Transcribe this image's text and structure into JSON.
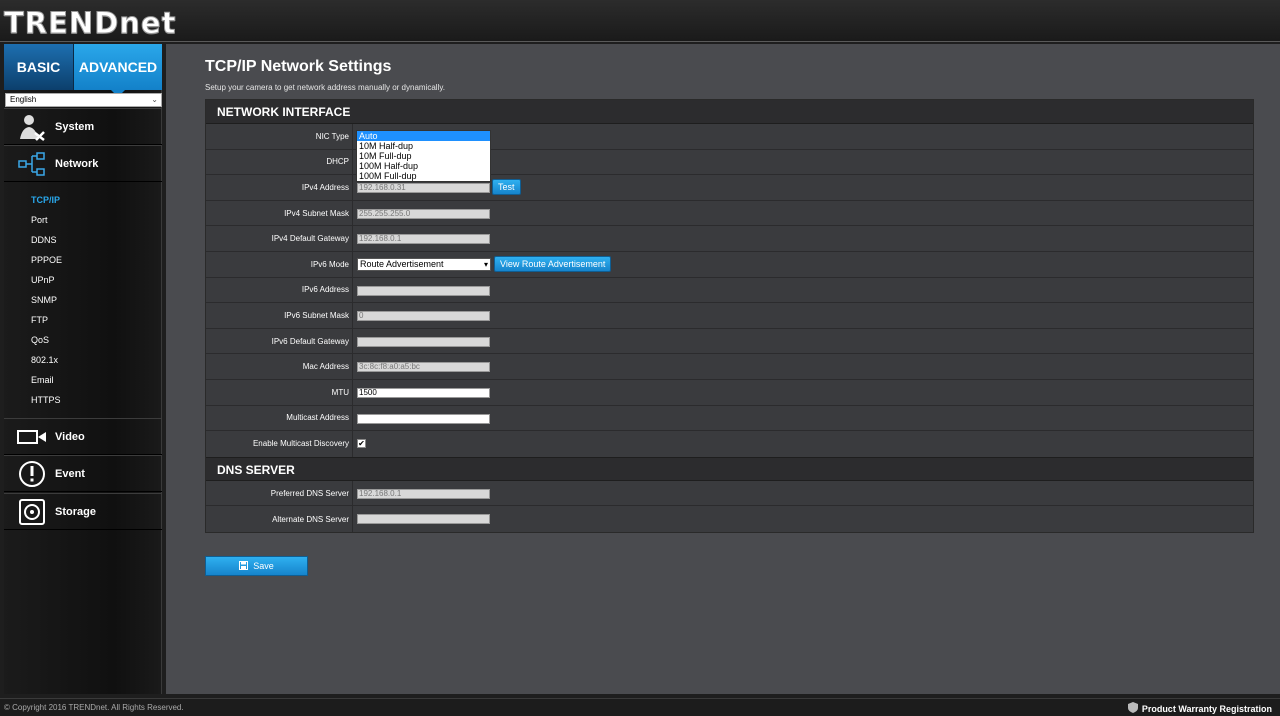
{
  "brand": {
    "logo_text": "TRENDnet"
  },
  "tabs": {
    "basic": "BASIC",
    "advanced": "ADVANCED"
  },
  "language": {
    "selected": "English"
  },
  "menu": {
    "system": "System",
    "network": "Network",
    "video": "Video",
    "event": "Event",
    "storage": "Storage"
  },
  "submenu": [
    "TCP/IP",
    "Port",
    "DDNS",
    "PPPOE",
    "UPnP",
    "SNMP",
    "FTP",
    "QoS",
    "802.1x",
    "Email",
    "HTTPS"
  ],
  "page": {
    "title": "TCP/IP Network Settings",
    "subtitle": "Setup your camera to get network address manually or dynamically."
  },
  "network_interface": {
    "heading": "NETWORK INTERFACE",
    "nic_type_label": "NIC Type",
    "nic_options": [
      "Auto",
      "10M Half-dup",
      "10M Full-dup",
      "100M Half-dup",
      "100M Full-dup"
    ],
    "dhcp_label": "DHCP",
    "ipv4_address_label": "IPv4 Address",
    "ipv4_address": "192.168.0.31",
    "test_button": "Test",
    "ipv4_subnet_label": "IPv4 Subnet Mask",
    "ipv4_subnet": "255.255.255.0",
    "ipv4_gateway_label": "IPv4 Default Gateway",
    "ipv4_gateway": "192.168.0.1",
    "ipv6_mode_label": "IPv6 Mode",
    "ipv6_mode": "Route Advertisement",
    "view_route_button": "View Route Advertisement",
    "ipv6_address_label": "IPv6 Address",
    "ipv6_address": "",
    "ipv6_subnet_label": "IPv6 Subnet Mask",
    "ipv6_subnet": "0",
    "ipv6_gateway_label": "IPv6 Default Gateway",
    "ipv6_gateway": "",
    "mac_label": "Mac Address",
    "mac": "3c:8c:f8:a0:a5:bc",
    "mtu_label": "MTU",
    "mtu": "1500",
    "multicast_label": "Multicast Address",
    "multicast": "",
    "multicast_discovery_label": "Enable Multicast Discovery",
    "multicast_discovery_checked": true
  },
  "dns": {
    "heading": "DNS SERVER",
    "preferred_label": "Preferred DNS Server",
    "preferred": "192.168.0.1",
    "alternate_label": "Alternate DNS Server",
    "alternate": ""
  },
  "save_button": "Save",
  "footer": {
    "copyright": "© Copyright 2016 TRENDnet. All Rights Reserved.",
    "warranty": "Product Warranty Registration"
  },
  "colors": {
    "accent": "#29a8ec",
    "panel": "#4a4b4f"
  }
}
